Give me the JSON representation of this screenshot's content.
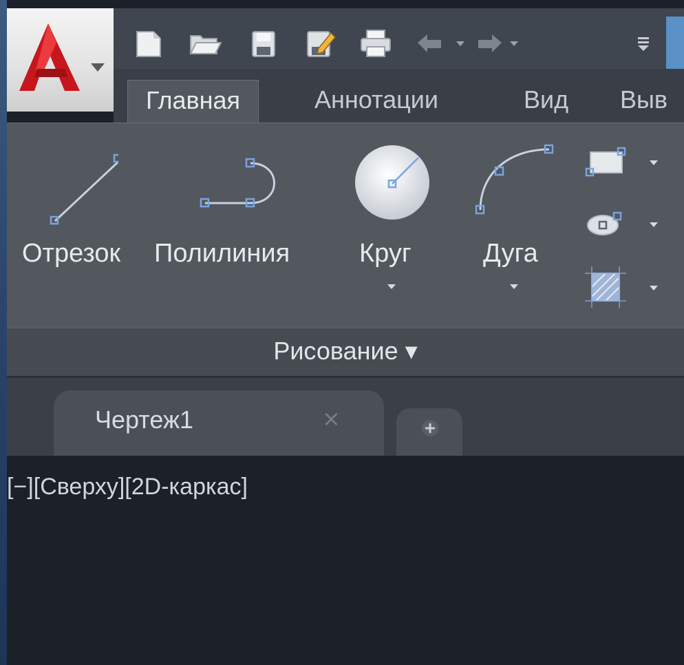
{
  "ribbon": {
    "tabs": [
      "Главная",
      "Аннотации",
      "Вид",
      "Выв"
    ],
    "active_tab": "Главная",
    "draw_tools": [
      {
        "label": "Отрезок",
        "icon": "line-icon"
      },
      {
        "label": "Полилиния",
        "icon": "polyline-icon"
      },
      {
        "label": "Круг",
        "icon": "circle-icon"
      },
      {
        "label": "Дуга",
        "icon": "arc-icon"
      }
    ],
    "small_tools": [
      "rectangle-icon",
      "ellipse-icon",
      "hatch-icon"
    ],
    "panel_title": "Рисование ▾"
  },
  "quick_access": {
    "icons": [
      "new-icon",
      "open-icon",
      "save-icon",
      "save-as-icon",
      "print-icon",
      "undo-icon",
      "redo-icon",
      "customize-icon"
    ]
  },
  "document": {
    "tab_label": "Чертеж1",
    "close_glyph": "×",
    "new_tab_glyph": "+"
  },
  "viewport": {
    "controls": "[−][Сверху][2D-каркас]"
  },
  "colors": {
    "accent_blue": "#5a91c6",
    "autocad_red": "#c8161d"
  }
}
